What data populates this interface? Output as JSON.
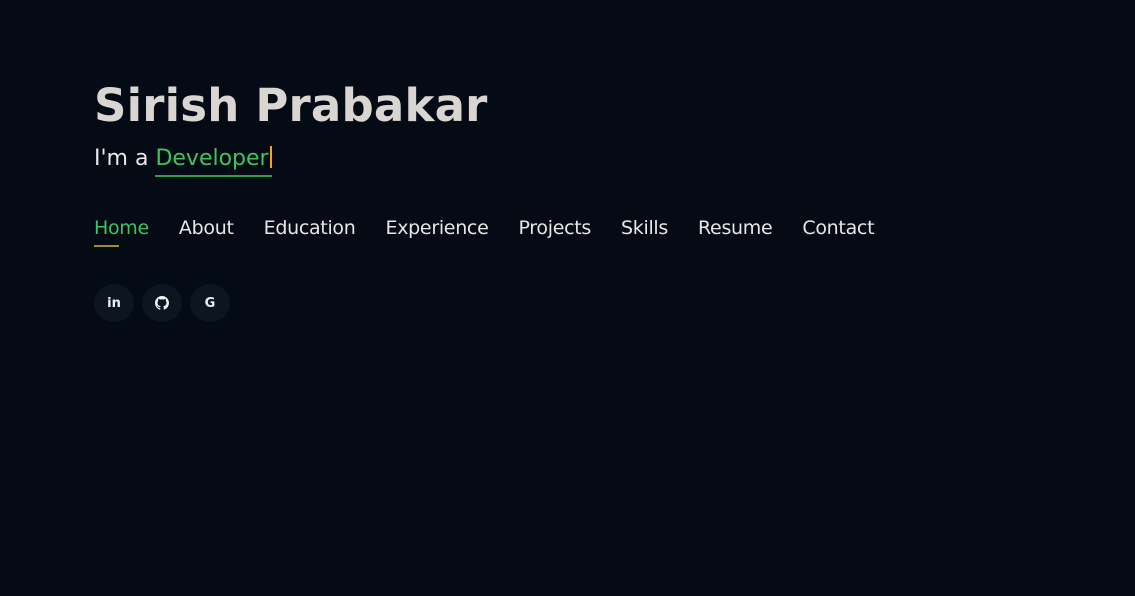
{
  "hero": {
    "name": "Sirish Prabakar",
    "prefix": "I'm a",
    "typed_role": "Developer"
  },
  "nav": {
    "items": [
      {
        "label": "Home",
        "active": true
      },
      {
        "label": "About"
      },
      {
        "label": "Education"
      },
      {
        "label": "Experience"
      },
      {
        "label": "Projects"
      },
      {
        "label": "Skills"
      },
      {
        "label": "Resume"
      },
      {
        "label": "Contact"
      }
    ]
  },
  "social": {
    "linkedin_text": "in",
    "github_icon": "github-icon",
    "google_text": "G"
  },
  "colors": {
    "background": "#040b14",
    "accent": "#3fc35f",
    "underline": "#a58a2b",
    "cursor": "#f0a619"
  }
}
